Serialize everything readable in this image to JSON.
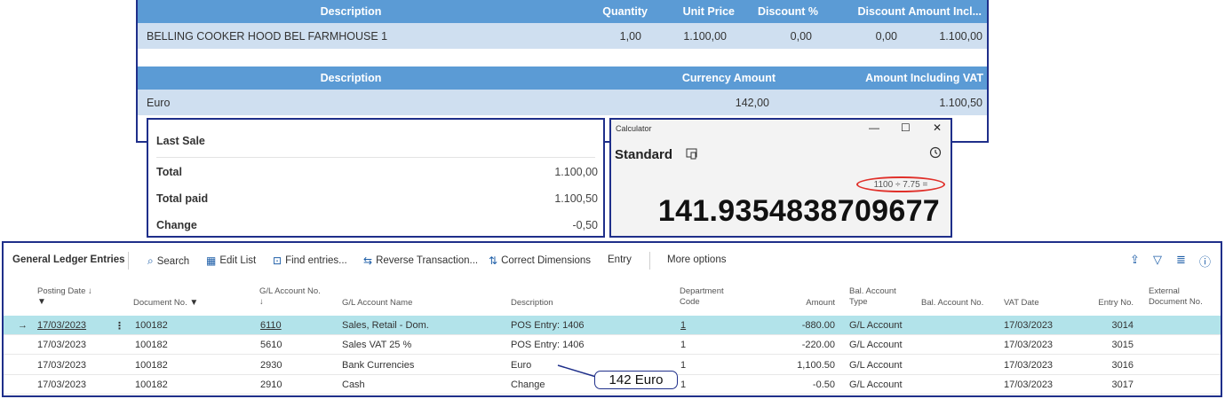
{
  "sale_lines": {
    "headers": {
      "description": "Description",
      "quantity": "Quantity",
      "unit_price": "Unit Price",
      "discount_pct": "Discount %",
      "discount": "Discount",
      "amount_incl": "Amount Incl..."
    },
    "row": {
      "description": "BELLING COOKER HOOD BEL FARMHOUSE 1",
      "quantity": "1,00",
      "unit_price": "1.100,00",
      "discount_pct": "0,00",
      "discount": "0,00",
      "amount_incl": "1.100,00"
    }
  },
  "payment_lines": {
    "headers": {
      "description": "Description",
      "currency_amount": "Currency Amount",
      "amount_incl_vat": "Amount Including VAT"
    },
    "row": {
      "description": "Euro",
      "currency_amount": "142,00",
      "amount_incl_vat": "1.100,50"
    }
  },
  "last_sale": {
    "title": "Last Sale",
    "total_label": "Total",
    "total_value": "1.100,00",
    "paid_label": "Total paid",
    "paid_value": "1.100,50",
    "change_label": "Change",
    "change_value": "-0,50"
  },
  "calculator": {
    "caption": "Calculator",
    "minimize": "—",
    "maximize": "☐",
    "close": "✕",
    "mode": "Standard",
    "keep_on_top_icon": "keep-on-top-icon",
    "history_icon": "history-icon",
    "expression": "1100 ÷ 7.75 =",
    "result": "141.9354838709677",
    "highlight_color": "#e0302a"
  },
  "ledger": {
    "title": "General Ledger Entries",
    "actions": {
      "search": "Search",
      "edit_list": "Edit List",
      "find_entries": "Find entries...",
      "reverse": "Reverse Transaction...",
      "correct_dims": "Correct Dimensions",
      "entry": "Entry",
      "more": "More options"
    },
    "columns": {
      "posting_date": "Posting Date ↓",
      "document_no": "Document No.",
      "gl_account_no": "G/L Account No.",
      "gl_account_no_sort": "↓",
      "gl_account_name": "G/L Account Name",
      "description": "Description",
      "department_code_1": "Department",
      "department_code_2": "Code",
      "amount": "Amount",
      "bal_account_type_1": "Bal. Account",
      "bal_account_type_2": "Type",
      "bal_account_no": "Bal. Account No.",
      "vat_date": "VAT Date",
      "entry_no": "Entry No.",
      "external_doc_1": "External",
      "external_doc_2": "Document No."
    },
    "rows": [
      {
        "posting_date": "17/03/2023",
        "document_no": "100182",
        "gl_account_no": "6110",
        "gl_account_name": "Sales, Retail - Dom.",
        "description": "POS Entry: 1406",
        "department_code": "1",
        "amount": "-880.00",
        "bal_account_type": "G/L Account",
        "vat_date": "17/03/2023",
        "entry_no": "3014"
      },
      {
        "posting_date": "17/03/2023",
        "document_no": "100182",
        "gl_account_no": "5610",
        "gl_account_name": "Sales VAT 25 %",
        "description": "POS Entry: 1406",
        "department_code": "1",
        "amount": "-220.00",
        "bal_account_type": "G/L Account",
        "vat_date": "17/03/2023",
        "entry_no": "3015"
      },
      {
        "posting_date": "17/03/2023",
        "document_no": "100182",
        "gl_account_no": "2930",
        "gl_account_name": "Bank Currencies",
        "description": "Euro",
        "department_code": "1",
        "amount": "1,100.50",
        "bal_account_type": "G/L Account",
        "vat_date": "17/03/2023",
        "entry_no": "3016"
      },
      {
        "posting_date": "17/03/2023",
        "document_no": "100182",
        "gl_account_no": "2910",
        "gl_account_name": "Cash",
        "description": "Change",
        "department_code": "1",
        "amount": "-0.50",
        "bal_account_type": "G/L Account",
        "vat_date": "17/03/2023",
        "entry_no": "3017"
      }
    ],
    "selection_color": "#b2e3ea"
  },
  "annotation": {
    "callout": "142 Euro"
  }
}
